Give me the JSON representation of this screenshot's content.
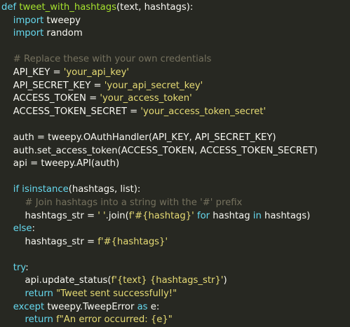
{
  "theme": {
    "background": "#272822",
    "text": "#f8f8f2",
    "keyword": "#66d9ef",
    "function": "#a6e22e",
    "string": "#e6db74",
    "comment": "#75715e"
  },
  "code": {
    "lines": [
      [
        [
          "kw",
          "def "
        ],
        [
          "fn",
          "tweet_with_hashtags"
        ],
        [
          "op",
          "(text, hashtags):"
        ]
      ],
      [
        [
          "op",
          "    "
        ],
        [
          "kw",
          "import"
        ],
        [
          "op",
          " tweepy"
        ]
      ],
      [
        [
          "op",
          "    "
        ],
        [
          "kw",
          "import"
        ],
        [
          "op",
          " random"
        ]
      ],
      [
        [
          "op",
          ""
        ]
      ],
      [
        [
          "op",
          "    "
        ],
        [
          "cmt",
          "# Replace these with your own credentials"
        ]
      ],
      [
        [
          "op",
          "    API_KEY = "
        ],
        [
          "str",
          "'your_api_key'"
        ]
      ],
      [
        [
          "op",
          "    API_SECRET_KEY = "
        ],
        [
          "str",
          "'your_api_secret_key'"
        ]
      ],
      [
        [
          "op",
          "    ACCESS_TOKEN = "
        ],
        [
          "str",
          "'your_access_token'"
        ]
      ],
      [
        [
          "op",
          "    ACCESS_TOKEN_SECRET = "
        ],
        [
          "str",
          "'your_access_token_secret'"
        ]
      ],
      [
        [
          "op",
          ""
        ]
      ],
      [
        [
          "op",
          "    auth = tweepy.OAuthHandler(API_KEY, API_SECRET_KEY)"
        ]
      ],
      [
        [
          "op",
          "    auth.set_access_token(ACCESS_TOKEN, ACCESS_TOKEN_SECRET)"
        ]
      ],
      [
        [
          "op",
          "    api = tweepy.API(auth)"
        ]
      ],
      [
        [
          "op",
          ""
        ]
      ],
      [
        [
          "op",
          "    "
        ],
        [
          "kw",
          "if"
        ],
        [
          "op",
          " "
        ],
        [
          "kw",
          "isinstance"
        ],
        [
          "op",
          "(hashtags, list):"
        ]
      ],
      [
        [
          "op",
          "        "
        ],
        [
          "cmt",
          "# Join hashtags into a string with the '#' prefix"
        ]
      ],
      [
        [
          "op",
          "        hashtags_str = "
        ],
        [
          "str",
          "' '"
        ],
        [
          "op",
          ".join("
        ],
        [
          "str",
          "f'#{hashtag}'"
        ],
        [
          "op",
          " "
        ],
        [
          "kw",
          "for"
        ],
        [
          "op",
          " hashtag "
        ],
        [
          "kw",
          "in"
        ],
        [
          "op",
          " hashtags)"
        ]
      ],
      [
        [
          "op",
          "    "
        ],
        [
          "kw",
          "else"
        ],
        [
          "op",
          ":"
        ]
      ],
      [
        [
          "op",
          "        hashtags_str = "
        ],
        [
          "str",
          "f'#{hashtags}'"
        ]
      ],
      [
        [
          "op",
          ""
        ]
      ],
      [
        [
          "op",
          "    "
        ],
        [
          "kw",
          "try"
        ],
        [
          "op",
          ":"
        ]
      ],
      [
        [
          "op",
          "        api.update_status("
        ],
        [
          "str",
          "f'{text} {hashtags_str}'"
        ],
        [
          "op",
          ")"
        ]
      ],
      [
        [
          "op",
          "        "
        ],
        [
          "kw",
          "return"
        ],
        [
          "op",
          " "
        ],
        [
          "str",
          "\"Tweet sent successfully!\""
        ]
      ],
      [
        [
          "op",
          "    "
        ],
        [
          "kw",
          "except"
        ],
        [
          "op",
          " tweepy.TweepError "
        ],
        [
          "kw",
          "as"
        ],
        [
          "op",
          " e:"
        ]
      ],
      [
        [
          "op",
          "        "
        ],
        [
          "kw",
          "return"
        ],
        [
          "op",
          " "
        ],
        [
          "str",
          "f\"An error occurred: {e}\""
        ]
      ]
    ]
  }
}
